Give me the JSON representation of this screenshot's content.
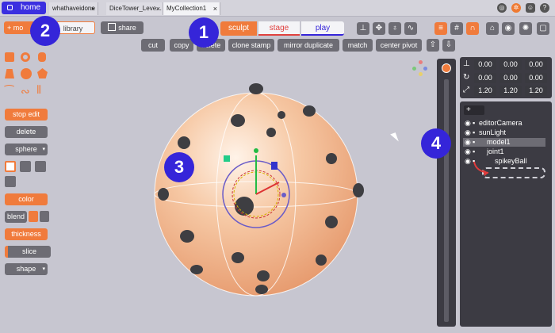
{
  "tabs": {
    "home": "home",
    "docs": [
      {
        "label": "whathaveidone",
        "close": "×"
      },
      {
        "label": "DiceTower_Leve...",
        "close": "×"
      },
      {
        "label": "MyCollection1",
        "close": "×"
      }
    ]
  },
  "toolbar_icons": [
    "compass-icon",
    "settings-icon",
    "discord-icon",
    "help-icon"
  ],
  "left_toolbar": {
    "add_label": "+ mo",
    "library_label": "library",
    "share_label": "share"
  },
  "modes": {
    "sculpt": "sculpt",
    "stage": "stage",
    "play": "play"
  },
  "edit_actions": [
    "cut",
    "copy",
    "delete",
    "clone stamp",
    "mirror duplicate",
    "match",
    "center pivot"
  ],
  "left_panel": {
    "stop_edit": "stop edit",
    "delete": "delete",
    "sphere": "sphere",
    "color": "color",
    "blend": "blend",
    "thickness": "thickness",
    "slice": "slice",
    "shape": "shape"
  },
  "transform": {
    "position": [
      "0.00",
      "0.00",
      "0.00"
    ],
    "rotation": [
      "0.00",
      "0.00",
      "0.00"
    ],
    "scale": [
      "1.20",
      "1.20",
      "1.20"
    ]
  },
  "scene_tree": [
    {
      "label": "editorCamera",
      "selected": false
    },
    {
      "label": "sunLight",
      "selected": false
    },
    {
      "label": "model1",
      "selected": true
    },
    {
      "label": "joint1",
      "selected": false
    },
    {
      "label": "spikeyBall",
      "selected": false
    }
  ],
  "annotations": [
    "1",
    "2",
    "3",
    "4"
  ],
  "colors": {
    "accent": "#f07b3c",
    "badge": "#3525d9",
    "panel": "#3c3b43"
  }
}
